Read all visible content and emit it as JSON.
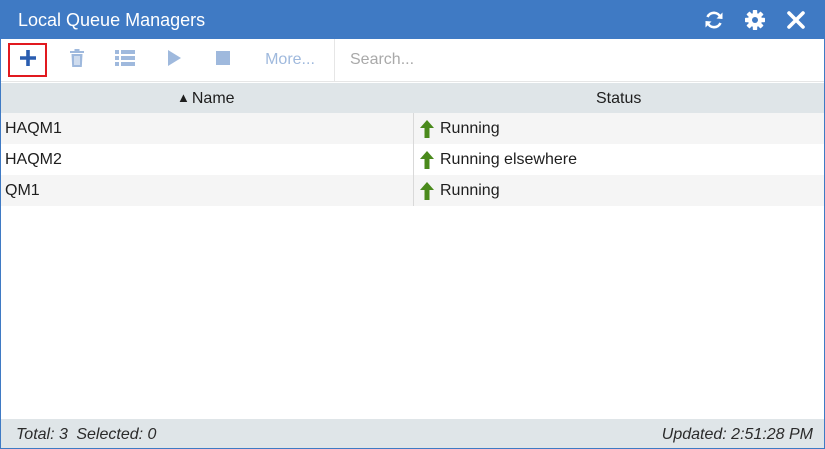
{
  "window": {
    "title": "Local Queue Managers",
    "controls": [
      "refresh-icon",
      "gear-icon",
      "close-icon"
    ]
  },
  "toolbar": {
    "buttons": [
      {
        "name": "add",
        "icon": "plus-icon"
      },
      {
        "name": "delete",
        "icon": "trash-icon"
      },
      {
        "name": "properties",
        "icon": "list-icon"
      },
      {
        "name": "start",
        "icon": "play-icon"
      },
      {
        "name": "stop",
        "icon": "stop-icon"
      }
    ],
    "more_label": "More...",
    "search_placeholder": "Search..."
  },
  "table": {
    "columns": [
      {
        "label": "Name",
        "sort": "ascending"
      },
      {
        "label": "Status"
      }
    ],
    "rows": [
      {
        "name": "HAQM1",
        "status": "Running",
        "status_icon": "up-arrow-icon"
      },
      {
        "name": "HAQM2",
        "status": "Running elsewhere",
        "status_icon": "up-arrow-icon"
      },
      {
        "name": "QM1",
        "status": "Running",
        "status_icon": "up-arrow-icon"
      }
    ]
  },
  "statusbar": {
    "total_label": "Total:",
    "total_value": "3",
    "selected_label": "Selected:",
    "selected_value": "0",
    "updated_label": "Updated:",
    "updated_value": "2:51:28 PM"
  },
  "colors": {
    "accent": "#3f7ac4",
    "header_bg": "#dfe5e8",
    "status_ok": "#4a8a1c",
    "highlight": "#e1191f",
    "disabled_icon": "#9fb9dd"
  }
}
